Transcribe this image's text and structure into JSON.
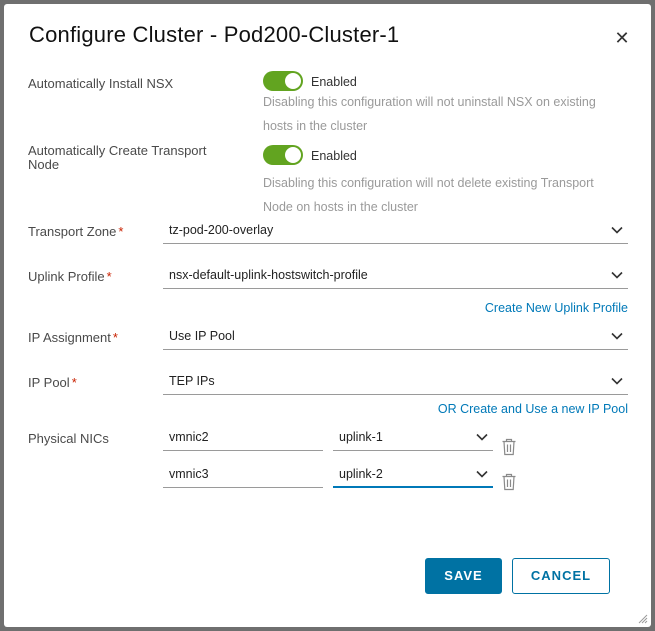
{
  "dialog": {
    "title": "Configure Cluster - Pod200-Cluster-1",
    "close_icon": "close-icon"
  },
  "auto_install": {
    "label": "Automatically Install NSX",
    "toggle_text": "Enabled",
    "enabled": true,
    "hint_line1": "Disabling this configuration will not uninstall NSX on existing",
    "hint_line2": "hosts in the cluster"
  },
  "auto_transport": {
    "label_line1": "Automatically Create Transport",
    "label_line2": "Node",
    "toggle_text": "Enabled",
    "enabled": true,
    "hint_line1": "Disabling this configuration will not delete existing Transport",
    "hint_line2": "Node on hosts in the cluster"
  },
  "transport_zone": {
    "label": "Transport Zone",
    "required": "*",
    "value": "tz-pod-200-overlay"
  },
  "uplink_profile": {
    "label": "Uplink Profile",
    "required": "*",
    "value": "nsx-default-uplink-hostswitch-profile",
    "link": "Create New Uplink Profile"
  },
  "ip_assignment": {
    "label": "IP Assignment",
    "required": "*",
    "value": "Use IP Pool"
  },
  "ip_pool": {
    "label": "IP Pool",
    "required": "*",
    "value": "TEP IPs",
    "link": "OR Create and Use a new IP Pool"
  },
  "physical_nics": {
    "label": "Physical NICs",
    "rows": [
      {
        "nic": "vmnic2",
        "uplink": "uplink-1"
      },
      {
        "nic": "vmnic3",
        "uplink": "uplink-2"
      }
    ]
  },
  "footer": {
    "save_label": "SAVE",
    "cancel_label": "CANCEL"
  },
  "colors": {
    "toggle_on": "#62a420",
    "primary": "#0072a3",
    "link": "#0079b8",
    "required": "#c92100"
  }
}
